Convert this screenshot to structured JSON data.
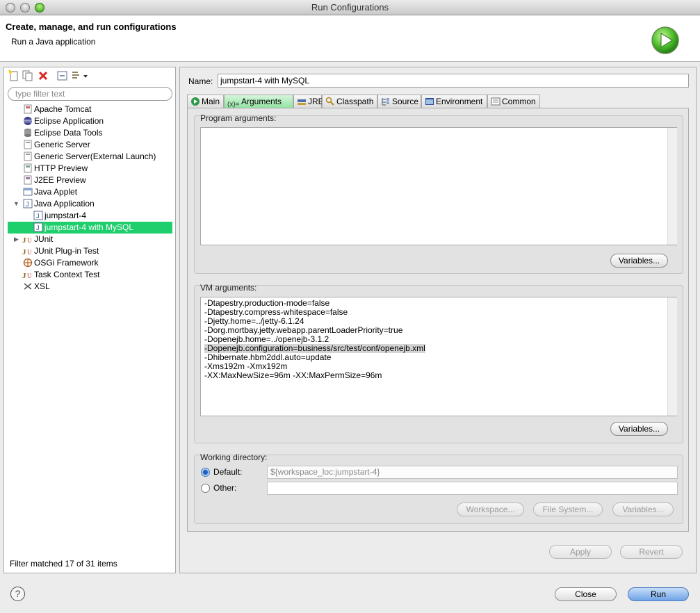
{
  "window": {
    "title": "Run Configurations"
  },
  "header": {
    "title": "Create, manage, and run configurations",
    "subtitle": "Run a Java application"
  },
  "left": {
    "filter_placeholder": "type filter text",
    "tree": [
      {
        "label": "Apache Tomcat",
        "icon": "tomcat-icon"
      },
      {
        "label": "Eclipse Application",
        "icon": "eclipse-app-icon"
      },
      {
        "label": "Eclipse Data Tools",
        "icon": "data-tools-icon"
      },
      {
        "label": "Generic Server",
        "icon": "server-icon"
      },
      {
        "label": "Generic Server(External Launch)",
        "icon": "server-icon"
      },
      {
        "label": "HTTP Preview",
        "icon": "http-preview-icon"
      },
      {
        "label": "J2EE Preview",
        "icon": "j2ee-preview-icon"
      },
      {
        "label": "Java Applet",
        "icon": "applet-icon"
      },
      {
        "label": "Java Application",
        "icon": "java-app-icon"
      },
      {
        "label": "jumpstart-4",
        "icon": "java-config-icon"
      },
      {
        "label": "jumpstart-4 with MySQL",
        "icon": "java-config-icon"
      },
      {
        "label": "JUnit",
        "icon": "junit-icon"
      },
      {
        "label": "JUnit Plug-in Test",
        "icon": "junit-plugin-icon"
      },
      {
        "label": "OSGi Framework",
        "icon": "osgi-icon"
      },
      {
        "label": "Task Context Test",
        "icon": "task-context-icon"
      },
      {
        "label": "XSL",
        "icon": "xsl-icon"
      }
    ],
    "status": "Filter matched 17 of 31 items"
  },
  "config": {
    "name_label": "Name:",
    "name_value": "jumpstart-4 with MySQL",
    "tabs": [
      "Main",
      "Arguments",
      "JRE",
      "Classpath",
      "Source",
      "Environment",
      "Common"
    ],
    "program_args_label": "Program arguments:",
    "program_args_value": "",
    "variables_label": "Variables...",
    "vm_args_label": "VM arguments:",
    "vm_args": [
      "-Dtapestry.production-mode=false",
      "-Dtapestry.compress-whitespace=false",
      "-Djetty.home=../jetty-6.1.24",
      "-Dorg.mortbay.jetty.webapp.parentLoaderPriority=true",
      "-Dopenejb.home=../openejb-3.1.2",
      "-Dopenejb.configuration=business/src/test/conf/openejb.xml",
      "-Dhibernate.hbm2ddl.auto=update",
      "-Xms192m -Xmx192m",
      "-XX:MaxNewSize=96m -XX:MaxPermSize=96m"
    ],
    "working_dir_label": "Working directory:",
    "default_label": "Default:",
    "default_value": "${workspace_loc:jumpstart-4}",
    "other_label": "Other:",
    "other_value": "",
    "workspace_btn": "Workspace...",
    "filesystem_btn": "File System...",
    "wd_variables_btn": "Variables...",
    "apply_btn": "Apply",
    "revert_btn": "Revert"
  },
  "footer": {
    "close_btn": "Close",
    "run_btn": "Run",
    "help_symbol": "?"
  },
  "colors": {
    "selection": "#1fce6c",
    "run_button": "#6ea3e6",
    "active_tab": "#8fe3a0"
  }
}
